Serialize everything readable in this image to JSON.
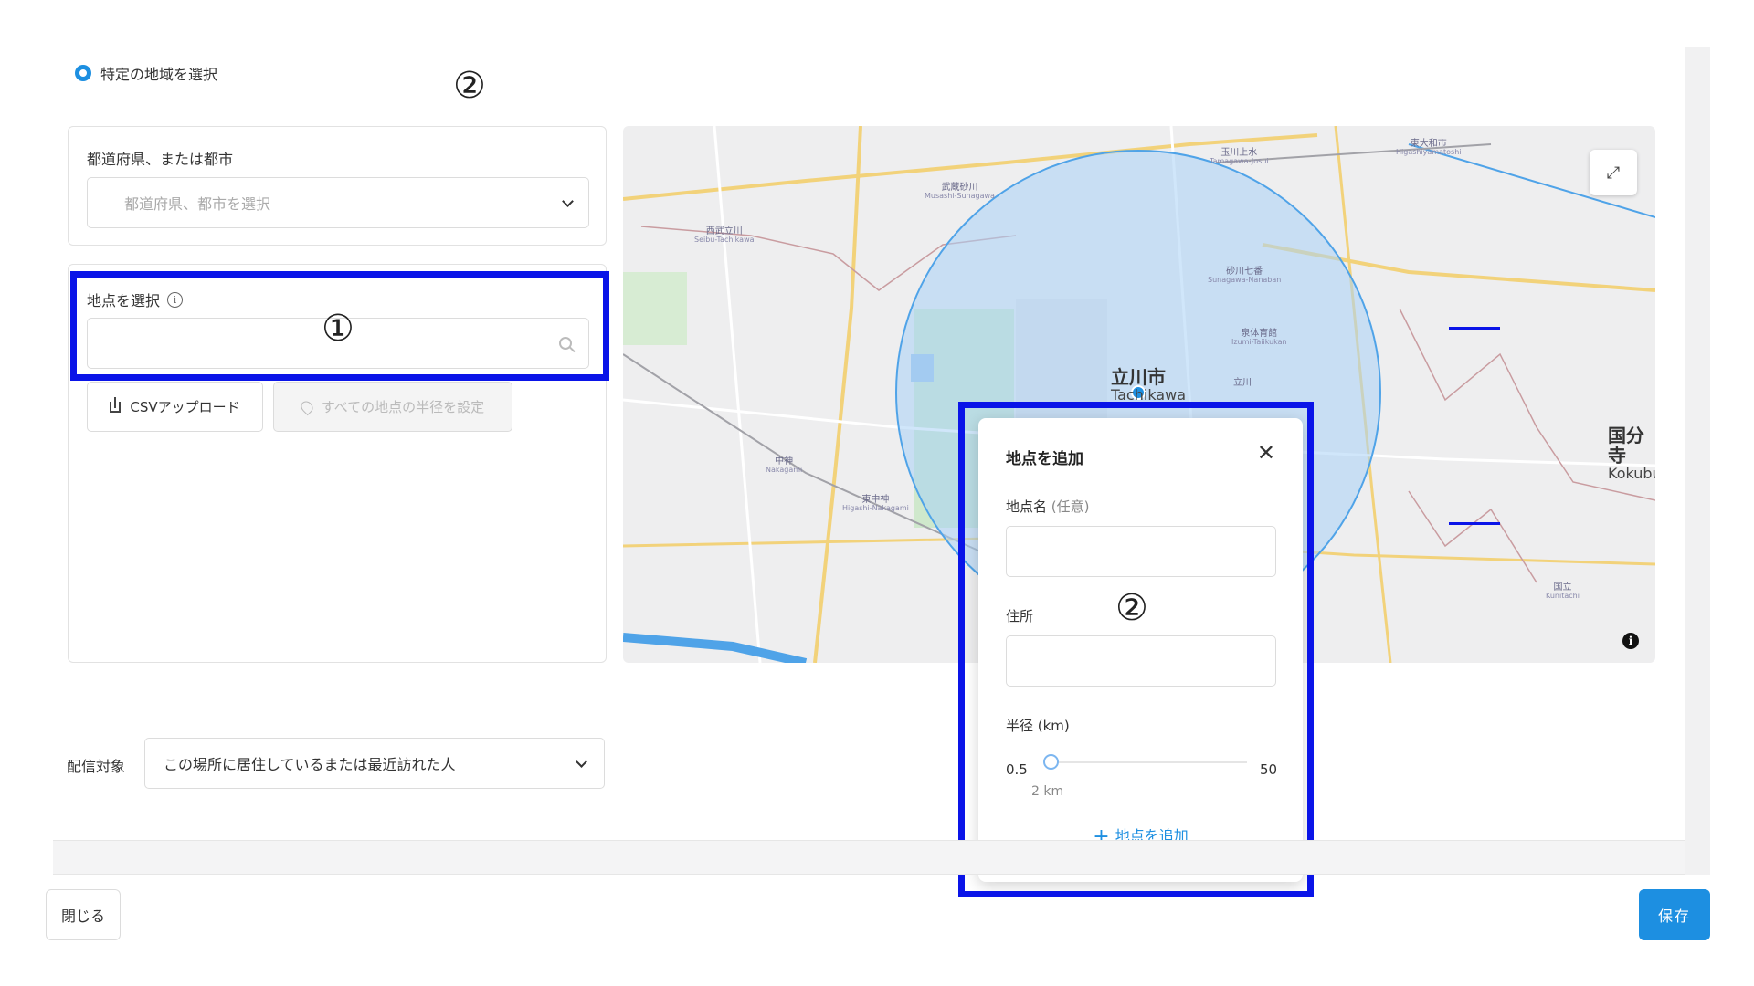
{
  "region": {
    "radio_label": "特定の地域を選択",
    "annotation_top": "②"
  },
  "prefecture": {
    "label": "都道府県、または都市",
    "placeholder": "都道府県、都市を選択"
  },
  "point": {
    "label": "地点を選択",
    "info_glyph": "i",
    "annotation": "①",
    "csv_button": "CSVアップロード",
    "radius_all_button": "すべての地点の半径を設定"
  },
  "map": {
    "city_name": "立川市",
    "city_romaji": "Tachikawa",
    "city_right": "国分寺",
    "city_right_romaji": "Kokubu",
    "stations": [
      {
        "name": "武蔵砂川",
        "romaji": "Musashi-Sunagawa"
      },
      {
        "name": "西武立川",
        "romaji": "Seibu-Tachikawa"
      },
      {
        "name": "玉川上水",
        "romaji": "Tamagawa-Josui"
      },
      {
        "name": "東大和市",
        "romaji": "Higashiyamatoshi"
      },
      {
        "name": "砂川七番",
        "romaji": "Sunagawa-Nanaban"
      },
      {
        "name": "泉体育館",
        "romaji": "Izumi-Taiikukan"
      },
      {
        "name": "中神",
        "romaji": "Nakagami"
      },
      {
        "name": "東中神",
        "romaji": "Higashi-Nakagami"
      },
      {
        "name": "国立",
        "romaji": "Kunitachi"
      },
      {
        "name": "立川",
        "romaji": ""
      }
    ],
    "expand_glyph": "⤢",
    "attribution_glyph": "i",
    "colors": {
      "radius_fill": "#a9d1f5",
      "radius_stroke": "#4fa3e8",
      "highlight": "#0a14e8"
    }
  },
  "popup": {
    "title": "地点を追加",
    "close_glyph": "✕",
    "name_label": "地点名",
    "name_optional": "(任意)",
    "address_label": "住所",
    "annotation": "②",
    "radius_label": "半径 (km)",
    "radius_min": "0.5",
    "radius_max": "50",
    "radius_value_text": "2 km",
    "radius_fraction": 0.03,
    "add_link": "地点を追加",
    "add_glyph": "+"
  },
  "delivery": {
    "label": "配信対象",
    "value": "この場所に居住しているまたは最近訪れた人"
  },
  "footer": {
    "close_button": "閉じる",
    "save_button": "保存"
  },
  "colors": {
    "accent": "#1d8fe1",
    "annotation_box": "#0a14e8"
  }
}
